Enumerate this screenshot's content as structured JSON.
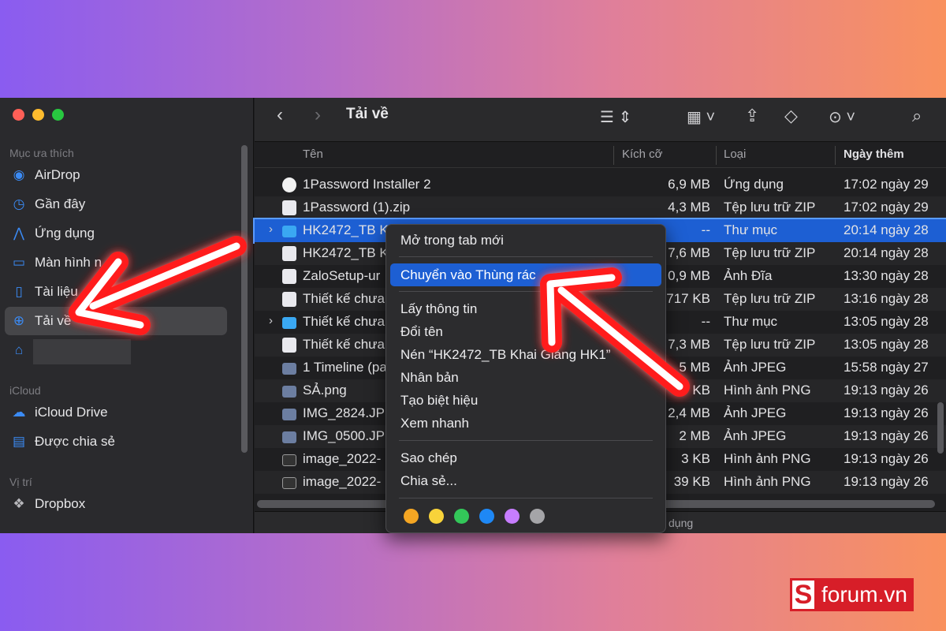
{
  "window": {
    "title": "Tải về"
  },
  "sidebar": {
    "sections": [
      {
        "label": "Mục ưa thích"
      },
      {
        "label": "iCloud"
      },
      {
        "label": "Vị trí"
      }
    ],
    "favorites": [
      {
        "label": "AirDrop",
        "icon": "airdrop-icon"
      },
      {
        "label": "Gần đây",
        "icon": "clock-icon"
      },
      {
        "label": "Ứng dụng",
        "icon": "applications-icon"
      },
      {
        "label": "Màn hình n",
        "icon": "desktop-icon"
      },
      {
        "label": "Tài liệu",
        "icon": "document-icon"
      },
      {
        "label": "Tải về",
        "icon": "download-icon"
      },
      {
        "label": "",
        "icon": "home-icon"
      }
    ],
    "icloud": [
      {
        "label": "iCloud Drive",
        "icon": "cloud-icon"
      },
      {
        "label": "Được chia sẻ",
        "icon": "shared-folder-icon"
      }
    ],
    "locations": [
      {
        "label": "Dropbox",
        "icon": "dropbox-icon"
      }
    ]
  },
  "columns": {
    "name": "Tên",
    "size": "Kích cỡ",
    "kind": "Loại",
    "date": "Ngày thêm"
  },
  "files": [
    {
      "name": "1Password Installer 2",
      "size": "6,9 MB",
      "kind": "Ứng dụng",
      "date": "17:02 ngày 29"
    },
    {
      "name": "1Password (1).zip",
      "size": "4,3 MB",
      "kind": "Tệp lưu trữ ZIP",
      "date": "17:02 ngày 29"
    },
    {
      "name": "HK2472_TB K",
      "size": "--",
      "kind": "Thư mục",
      "date": "20:14 ngày 28"
    },
    {
      "name": "HK2472_TB K",
      "size": "7,6 MB",
      "kind": "Tệp lưu trữ ZIP",
      "date": "20:14 ngày 28"
    },
    {
      "name": "ZaloSetup-ur",
      "size": "0,9 MB",
      "kind": "Ảnh Đĩa",
      "date": "13:30 ngày 28"
    },
    {
      "name": "Thiết kế chưa",
      "size": "717 KB",
      "kind": "Tệp lưu trữ ZIP",
      "date": "13:16 ngày 28"
    },
    {
      "name": "Thiết kế chưa",
      "size": "--",
      "kind": "Thư mục",
      "date": "13:05 ngày 28"
    },
    {
      "name": "Thiết kế chưa",
      "size": "7,3 MB",
      "kind": "Tệp lưu trữ ZIP",
      "date": "13:05 ngày 28"
    },
    {
      "name": "1 Timeline (pa",
      "size": "5 MB",
      "kind": "Ảnh JPEG",
      "date": "15:58 ngày 27"
    },
    {
      "name": "SẢ.png",
      "size": "KB",
      "kind": "Hình ảnh PNG",
      "date": "19:13 ngày 26"
    },
    {
      "name": "IMG_2824.JP",
      "size": "2,4 MB",
      "kind": "Ảnh JPEG",
      "date": "19:13 ngày 26"
    },
    {
      "name": "IMG_0500.JP",
      "size": "2 MB",
      "kind": "Ảnh JPEG",
      "date": "19:13 ngày 26"
    },
    {
      "name": "image_2022-",
      "size": "3 KB",
      "kind": "Hình ảnh PNG",
      "date": "19:13 ngày 26"
    },
    {
      "name": "image_2022-",
      "size": "39 KB",
      "kind": "Hình ảnh PNG",
      "date": "19:13 ngày 26"
    }
  ],
  "status": {
    "text": "dụng"
  },
  "context_menu": {
    "items": [
      "Mở trong tab mới",
      "Chuyển vào Thùng rác",
      "Lấy thông tin",
      "Đổi tên",
      "Nén “HK2472_TB Khai Giảng HK1”",
      "Nhân bản",
      "Tạo biệt hiệu",
      "Xem nhanh",
      "Sao chép",
      "Chia sẻ..."
    ],
    "tag_colors": [
      "#f5a623",
      "#f8d33a",
      "#33c759",
      "#1e88f5",
      "#c77dff",
      "#a5a5a8"
    ]
  },
  "logo": {
    "mark": "S",
    "text": "forum.vn"
  }
}
